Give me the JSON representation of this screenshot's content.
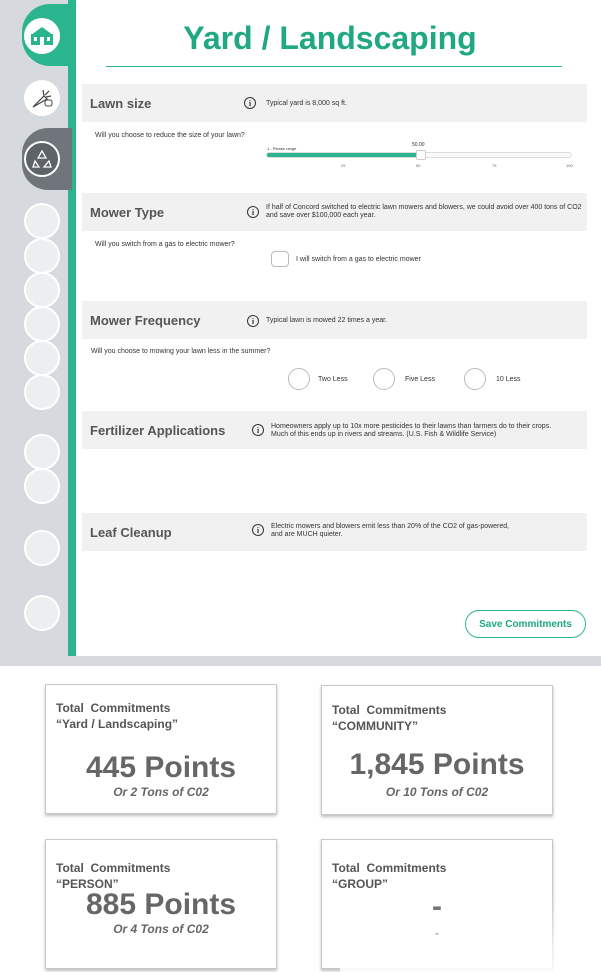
{
  "page": {
    "title": "Yard / Landscaping"
  },
  "rail": {
    "items": [
      {
        "icon": "house-icon",
        "state": "active"
      },
      {
        "icon": "carrot-icon",
        "state": "default"
      },
      {
        "icon": "recycle-icon",
        "state": "selected"
      },
      {
        "icon": "",
        "state": "empty"
      },
      {
        "icon": "",
        "state": "empty"
      },
      {
        "icon": "",
        "state": "empty"
      },
      {
        "icon": "",
        "state": "empty"
      },
      {
        "icon": "",
        "state": "empty"
      },
      {
        "icon": "",
        "state": "empty"
      },
      {
        "icon": "",
        "state": "empty"
      },
      {
        "icon": "",
        "state": "empty"
      },
      {
        "icon": "",
        "state": "empty"
      }
    ]
  },
  "sections": {
    "lawn": {
      "title": "Lawn size",
      "info": "Typical yard is 8,000 sq ft.",
      "question": "Will you choose to reduce the size of your lawn?",
      "slider": {
        "label": "1 - Please range",
        "value_label": "50.00",
        "value": 50,
        "min": 0,
        "max": 100,
        "ticks": [
          "25",
          "50",
          "75",
          "100"
        ]
      }
    },
    "mower": {
      "title": "Mower Type",
      "info_line1": "If half of Concord switched to electric lawn mowers and blowers, we could avoid over 400 tons of CO2",
      "info_line2": "and save over $100,000 each year.",
      "question": "Will you switch from a gas to electric mower?",
      "checkbox_label": "I will switch from a gas to electric mower"
    },
    "frequency": {
      "title": "Mower Frequency",
      "info": "Typical lawn is mowed 22 times a year.",
      "question": "Will you choose to mowing your lawn less in the summer?",
      "options": [
        "Two Less",
        "Five Less",
        "10 Less"
      ]
    },
    "fertilizer": {
      "title": "Fertilizer Applications",
      "info_line1": "Homeowners apply up to 10x more pesticides to their lawns than farmers do to their crops.",
      "info_line2": "Much of this ends up in rivers and streams. (U.S. Fish & Wildlife Service)"
    },
    "leaf": {
      "title": "Leaf Cleanup",
      "info_line1": "Electric mowers and blowers emit less than 20% of the CO2 of gas-powered,",
      "info_line2": "and are MUCH quieter."
    }
  },
  "save_button": "Save Commitments",
  "info_glyph": "i",
  "cards": {
    "yard": {
      "line1": "Total  Commitments",
      "line2": "“Yard / Landscaping”",
      "points": "445 Points",
      "tons": "Or 2 Tons of C02"
    },
    "community": {
      "line1": "Total  Commitments",
      "line2": "“COMMUNITY”",
      "points": "1,845 Points",
      "tons": "Or 10 Tons of C02"
    },
    "person": {
      "line1": "Total  Commitments",
      "line2": "“PERSON”",
      "points": "885 Points",
      "tons": "Or 4 Tons of C02"
    },
    "group": {
      "line1": "Total  Commitments",
      "line2": "“GROUP”",
      "points": "-",
      "tons": "-"
    }
  },
  "colors": {
    "accent": "#2bb58f",
    "title": "#1fa882",
    "rail": "#d6d9dd",
    "rail_dark": "#6f757a"
  }
}
